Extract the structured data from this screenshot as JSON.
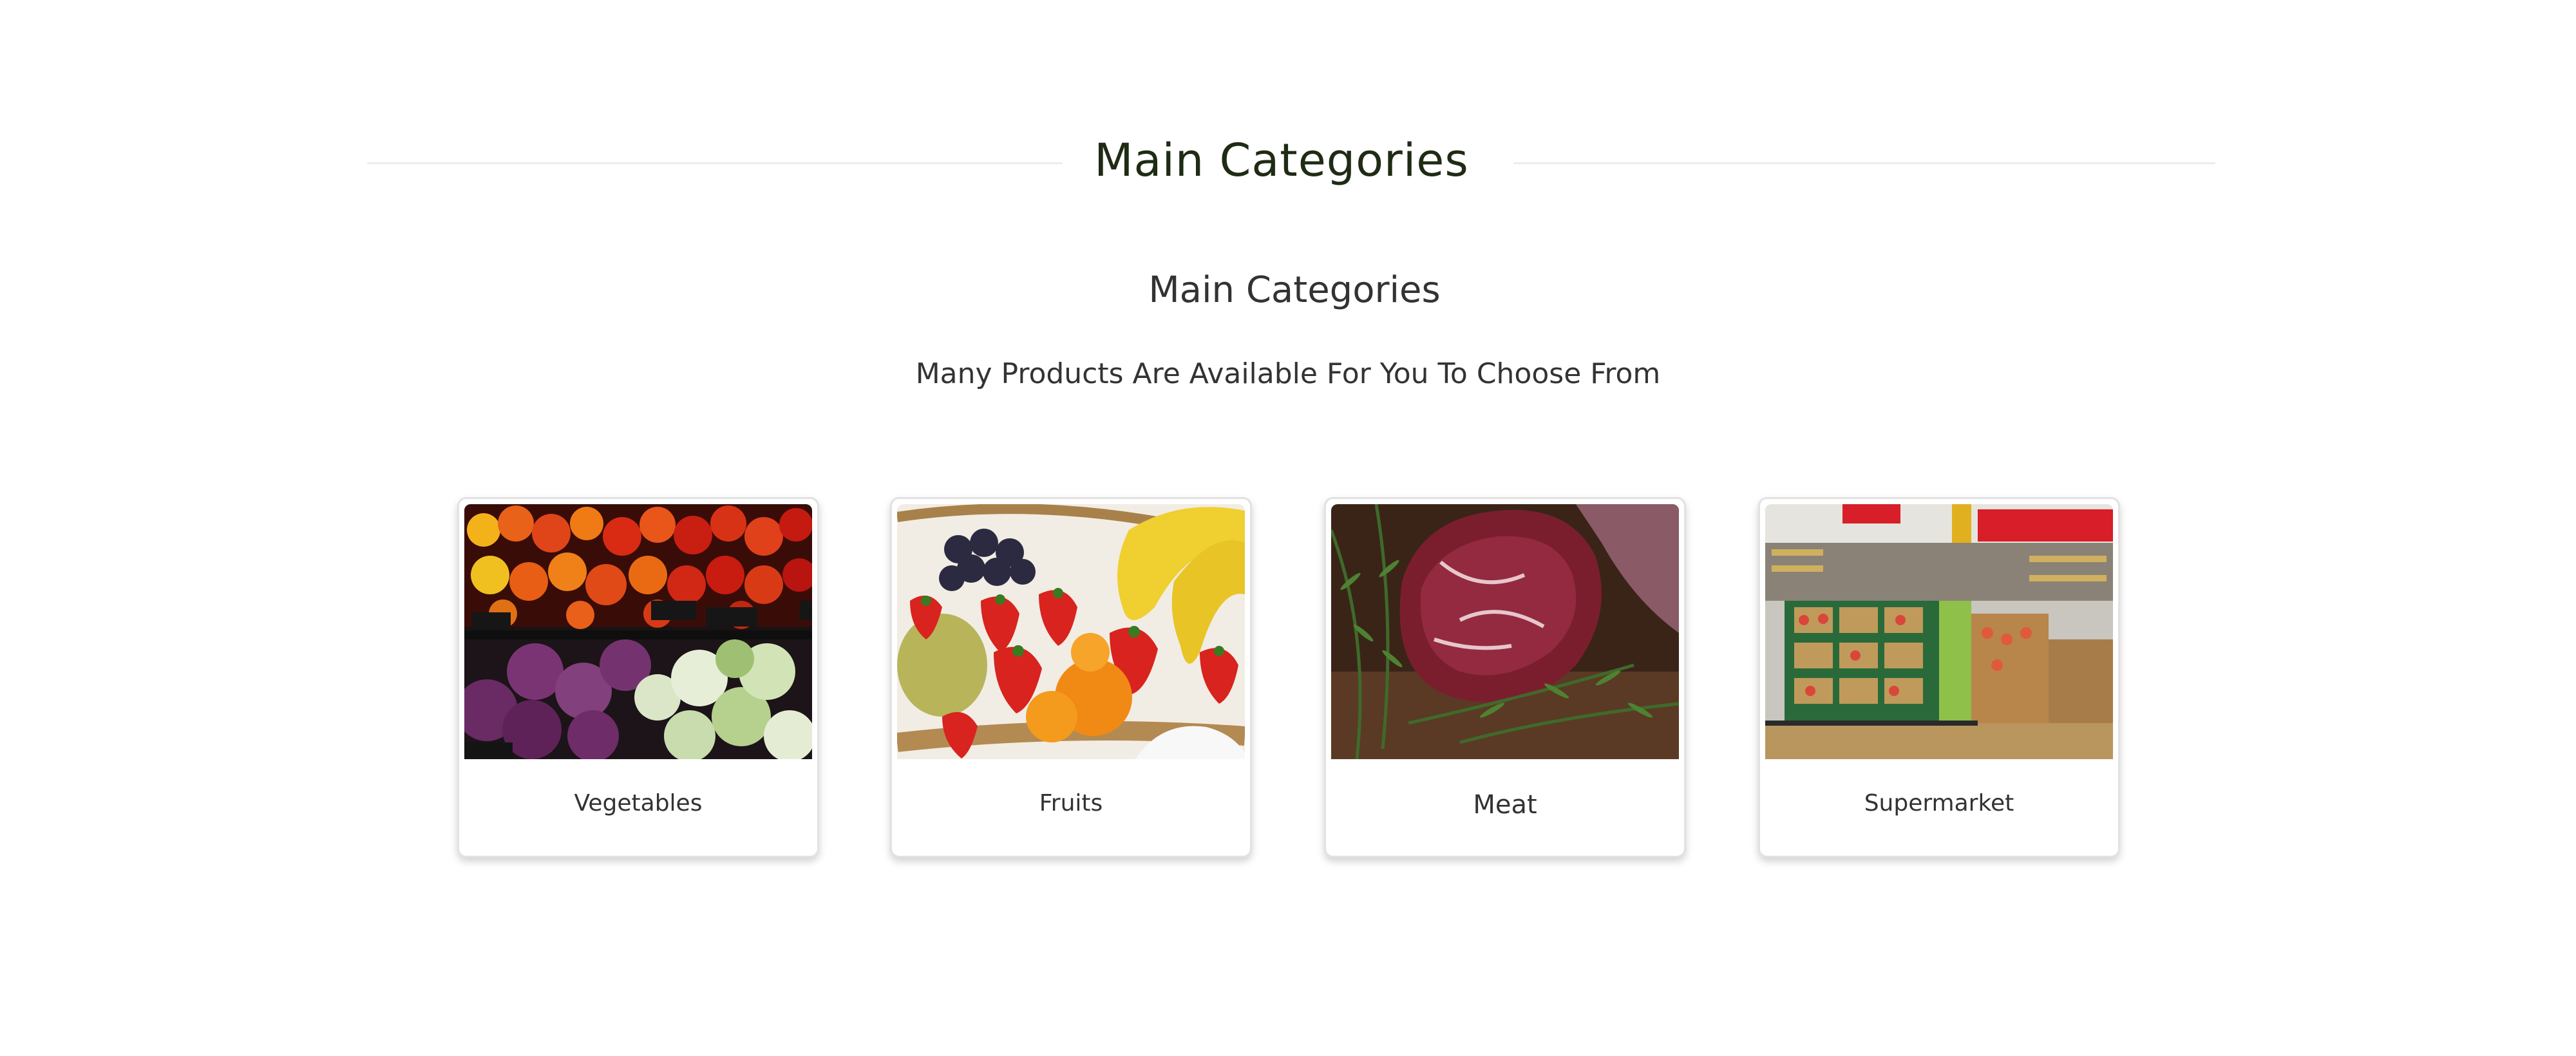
{
  "section": {
    "heading": "Main Categories"
  },
  "intro": {
    "title": "Main Categories",
    "tagline": "Many Products Are Available For You To Choose From"
  },
  "categories": [
    {
      "label": "Vegetables",
      "image": "vegetables-photo"
    },
    {
      "label": "Fruits",
      "image": "fruits-photo"
    },
    {
      "label": "Meat",
      "image": "meat-photo"
    },
    {
      "label": "Supermarket",
      "image": "supermarket-photo"
    }
  ],
  "colors": {
    "heading": "#1f2b14",
    "text": "#333333",
    "divider": "#ececec",
    "card_border": "#e2e2e2"
  }
}
